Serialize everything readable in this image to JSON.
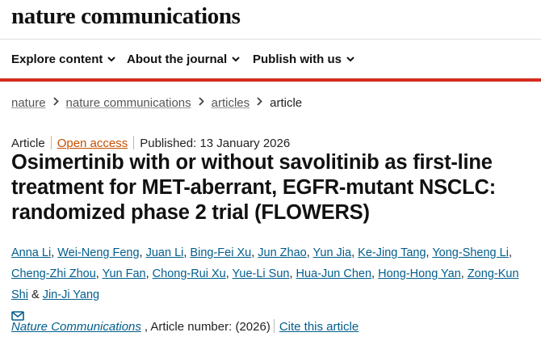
{
  "site": {
    "logo_text": "nature communications"
  },
  "nav": [
    {
      "label": "Explore content"
    },
    {
      "label": "About the journal"
    },
    {
      "label": "Publish with us"
    }
  ],
  "breadcrumb": [
    {
      "label": "nature"
    },
    {
      "label": "nature communications"
    },
    {
      "label": "articles"
    },
    {
      "label": "article"
    }
  ],
  "article": {
    "type": "Article",
    "access": "Open access",
    "published": "Published: 13 January 2026",
    "title": "Osimertinib with or without savolitinib as first-line treatment for MET-aberrant, EGFR-mutant NSCLC: randomized phase 2 trial (FLOWERS)",
    "authors": [
      "Anna Li",
      "Wei-Neng Feng",
      "Juan Li",
      "Bing-Fei Xu",
      "Jun Zhao",
      "Yun Jia",
      "Ke-Jing Tang",
      "Yong-Sheng Li",
      "Cheng-Zhi Zhou",
      "Yun Fan",
      "Chong-Rui Xu",
      "Yue-Li Sun",
      "Hua-Jun Chen",
      "Hong-Hong Yan",
      "Zong-Kun Shi",
      "Jin-Ji Yang"
    ],
    "author_separator": ",",
    "author_last_separator": "&"
  },
  "citation": {
    "journal": "Nature Communications",
    "article_number": ", Article number:  (2026)",
    "cite_label": "Cite this article"
  },
  "colors": {
    "accent_red": "#d52b1e",
    "link_blue": "#025e8d",
    "open_access_orange": "#c75000"
  },
  "icons": {
    "nav_dropdown": "chevron-down-icon",
    "breadcrumb_sep": "chevron-right-icon",
    "contact": "mail-icon"
  }
}
